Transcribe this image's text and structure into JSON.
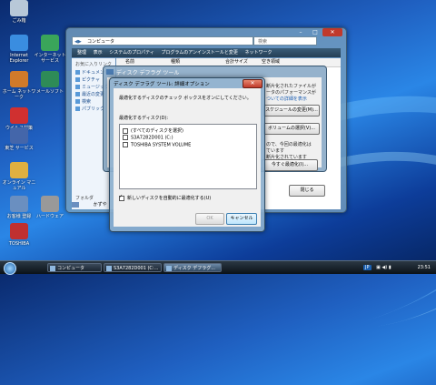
{
  "desktop": {
    "icons": [
      {
        "label": "ごみ箱",
        "color": "#b8c8d8"
      },
      {
        "label": "Internet Explorer",
        "color": "#3a8de0"
      },
      {
        "label": "インターネット サービス",
        "color": "#3aa55a"
      },
      {
        "label": "ホーム ネットワーク",
        "color": "#d07a2a"
      },
      {
        "label": "メールソフト",
        "color": "#2e8b57"
      },
      {
        "label": "ウイルス対策",
        "color": "#d03030"
      },
      {
        "label": "東芝 サービス",
        "color": "#4466aa"
      },
      {
        "label": "オンライン マニュアル",
        "color": "#e0b040"
      },
      {
        "label": "お客様 登録",
        "color": "#6a8fc0"
      },
      {
        "label": "TOSHIBA",
        "color": "#c03030"
      },
      {
        "label": "ハードウェア",
        "color": "#999999"
      }
    ]
  },
  "explorer": {
    "address": "コンピュータ",
    "search_placeholder": "検索",
    "toolbar": [
      "整理",
      "表示",
      "システムのプロパティ",
      "プログラムのアンインストールと変更",
      "ネットワーク"
    ],
    "columns": [
      "名前",
      "種類",
      "合計サイズ",
      "空き領域"
    ],
    "favorites_title": "お気に入りリンク",
    "favorites": [
      "ドキュメント",
      "ピクチャ",
      "ミュージック",
      "最近の変更",
      "検索",
      "パブリック"
    ],
    "folders_label": "フォルダ",
    "status_label": "かずや"
  },
  "defrag": {
    "title": "ディスク デフラグ ツール",
    "text_lines": [
      "断片化されたファイルが",
      "ータのパフォーマンスが",
      "ついての詳細を表示",
      "ので、今回の最適化は",
      "ています",
      "断片化されています"
    ],
    "buttons": [
      "スケジュールの変更(M)...",
      "ボリュームの選択(V)...",
      "今すぐ最適化(I)..."
    ],
    "close": "閉じる"
  },
  "dialog": {
    "title": "ディスク デフラグ ツール: 詳細オプション",
    "close_glyph": "✕",
    "instruction": "最適化するディスクのチェック ボックスをオンにしてください。",
    "list_label": "最適化するディスク(D):",
    "disks": [
      {
        "label": "(すべてのディスクを選択)",
        "checked": false
      },
      {
        "label": "S3A7282D001 (C:)",
        "checked": false
      },
      {
        "label": "TOSHIBA SYSTEM VOLUME",
        "checked": false
      }
    ],
    "auto_option": "新しいディスクを自動的に最適化する(U)",
    "auto_checked": true,
    "ok": "OK",
    "cancel": "キャンセル"
  },
  "taskbar": {
    "tasks": [
      {
        "label": "コンピュータ",
        "active": false
      },
      {
        "label": "S3A7282D001 (C:...",
        "active": false
      },
      {
        "label": "ディスク デフラグ...",
        "active": true
      }
    ],
    "language": "JP",
    "clock": "23:51"
  }
}
